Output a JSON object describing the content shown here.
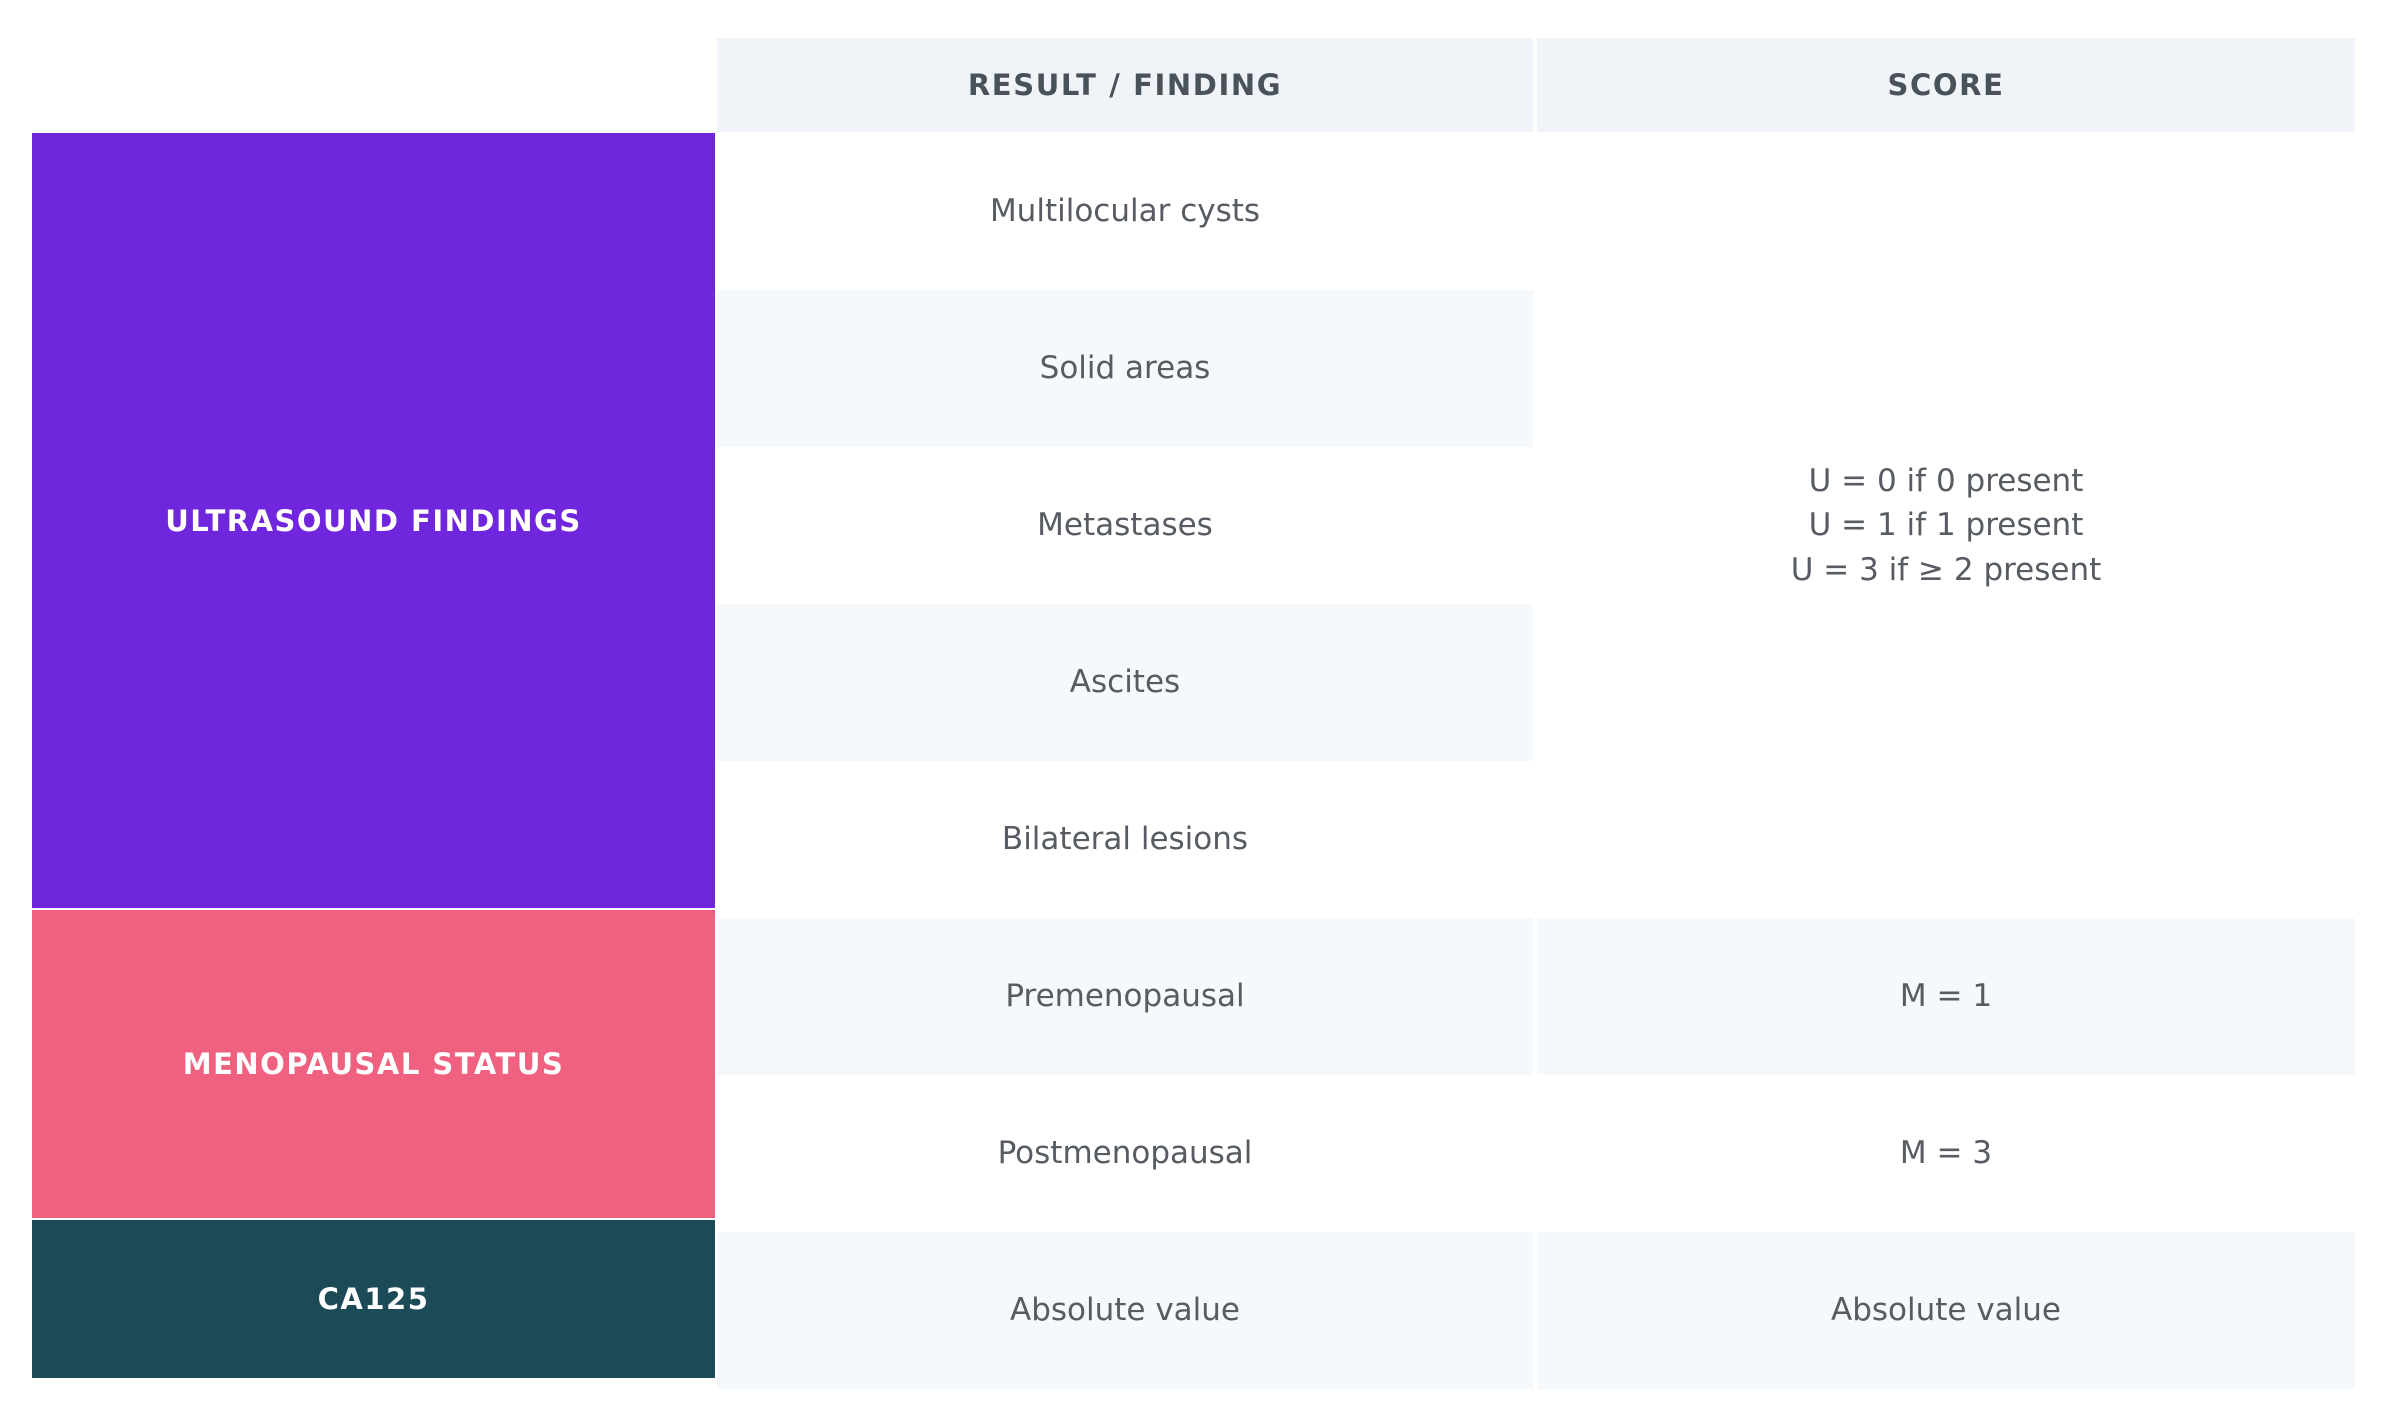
{
  "table": {
    "headers": {
      "category_column": "",
      "result": "RESULT / FINDING",
      "score": "SCORE"
    },
    "colors": {
      "ultrasound": "#6F26DD",
      "menopausal": "#EF617F",
      "ca125": "#1D4A57",
      "header_bg": "#F0F4F8",
      "row_shade": "#F6F9FB",
      "text": "#565C62",
      "header_text": "#4A5259"
    },
    "sections": [
      {
        "category": "ULTRASOUND FINDINGS",
        "rows": [
          {
            "result": "Multilocular cysts",
            "score": ""
          },
          {
            "result": "Solid areas",
            "score": ""
          },
          {
            "result": "Metastases",
            "score": ""
          },
          {
            "result": "Ascites",
            "score": ""
          },
          {
            "result": "Bilateral lesions",
            "score": ""
          }
        ],
        "merged_score": {
          "line1": "U = 0 if 0 present",
          "line2": "U = 1 if 1 present",
          "line3": "U = 3 if ≥ 2 present"
        }
      },
      {
        "category": "MENOPAUSAL STATUS",
        "rows": [
          {
            "result": "Premenopausal",
            "score": "M = 1"
          },
          {
            "result": "Postmenopausal",
            "score": "M = 3"
          }
        ]
      },
      {
        "category": "CA125",
        "rows": [
          {
            "result": "Absolute value",
            "score": "Absolute value"
          }
        ]
      }
    ]
  }
}
